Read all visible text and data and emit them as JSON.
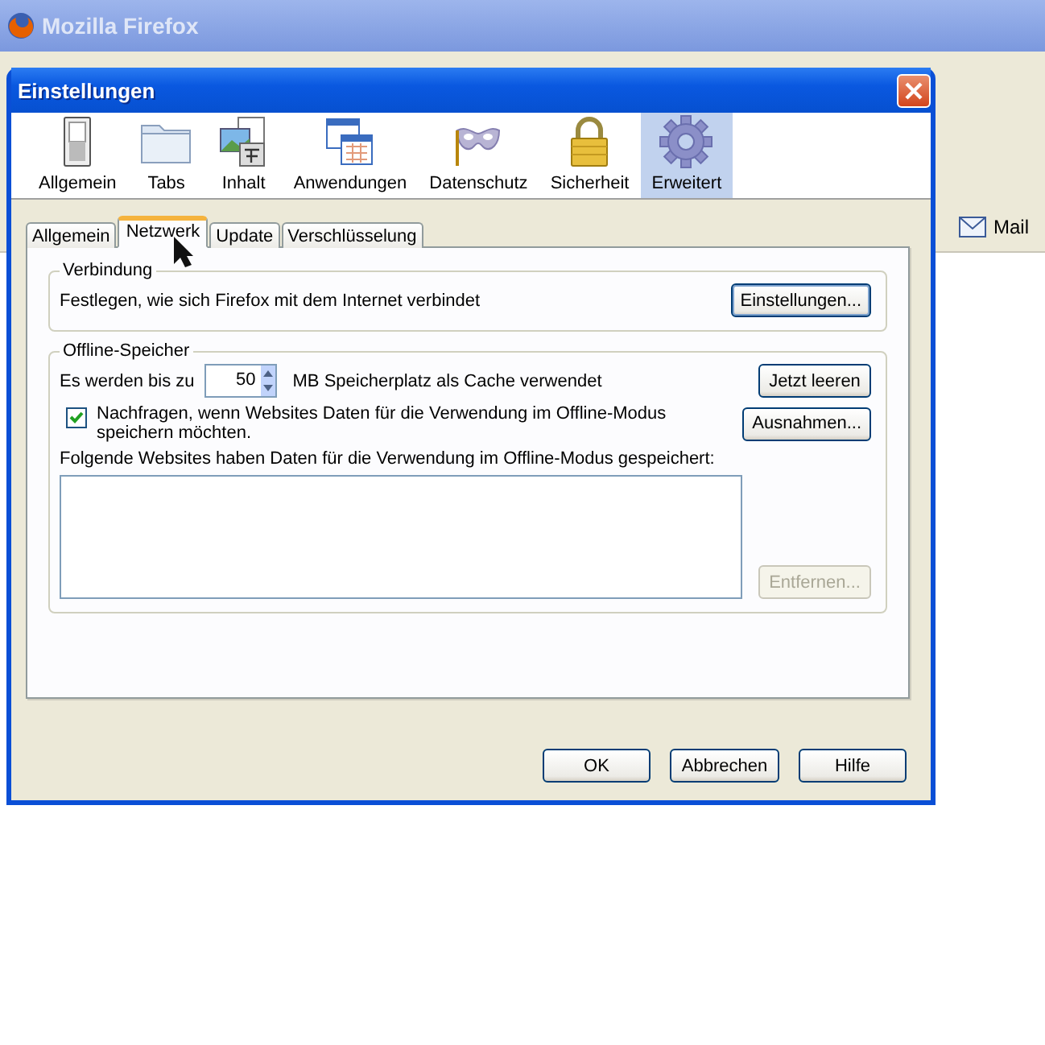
{
  "background_window": {
    "title": "Mozilla Firefox",
    "toolbar_button": "Mail"
  },
  "dialog": {
    "title": "Einstellungen",
    "panes": [
      {
        "label": "Allgemein",
        "selected": false
      },
      {
        "label": "Tabs",
        "selected": false
      },
      {
        "label": "Inhalt",
        "selected": false
      },
      {
        "label": "Anwendungen",
        "selected": false
      },
      {
        "label": "Datenschutz",
        "selected": false
      },
      {
        "label": "Sicherheit",
        "selected": false
      },
      {
        "label": "Erweitert",
        "selected": true
      }
    ],
    "tabs": [
      {
        "label": "Allgemein",
        "selected": false
      },
      {
        "label": "Netzwerk",
        "selected": true
      },
      {
        "label": "Update",
        "selected": false
      },
      {
        "label": "Verschlüsselung",
        "selected": false
      }
    ],
    "connection": {
      "title": "Verbindung",
      "text": "Festlegen, wie sich Firefox mit dem Internet verbindet",
      "button": "Einstellungen..."
    },
    "offline": {
      "title": "Offline-Speicher",
      "cache_prefix": "Es werden bis zu",
      "cache_value": "50",
      "cache_suffix": "MB Speicherplatz als Cache verwendet",
      "clear_button": "Jetzt leeren",
      "ask": {
        "label": "Nachfragen, wenn Websites Daten für die Verwendung im Offline-Modus speichern möchten.",
        "checked": true
      },
      "exceptions_button": "Ausnahmen...",
      "list_label": "Folgende Websites haben Daten für die Verwendung im Offline-Modus gespeichert:",
      "remove_button": {
        "label": "Entfernen...",
        "disabled": true
      }
    },
    "buttons": [
      "OK",
      "Abbrechen",
      "Hilfe"
    ]
  }
}
